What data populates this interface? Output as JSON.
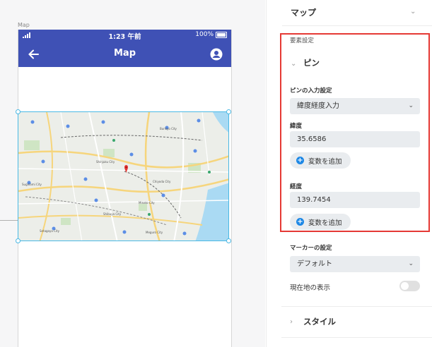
{
  "canvas": {
    "frame_label": "Map",
    "status_bar": {
      "time": "1:23 午前",
      "battery": "100%"
    },
    "app_bar": {
      "title": "Map"
    }
  },
  "panel": {
    "map_section": {
      "title": "マップ"
    },
    "element_settings_label": "要素設定",
    "pin_section": {
      "title": "ピン"
    },
    "pin_input_label": "ピンの入力設定",
    "pin_input_value": "緯度経度入力",
    "latitude_label": "緯度",
    "latitude_value": "35.6586",
    "longitude_label": "経度",
    "longitude_value": "139.7454",
    "add_variable_label": "変数を追加",
    "marker_label": "マーカーの設定",
    "marker_value": "デフォルト",
    "current_location_label": "現在地の表示",
    "current_location_on": false,
    "style_section": {
      "title": "スタイル"
    }
  },
  "colors": {
    "app_bar": "#3f51b5",
    "selection": "#4ab8e4",
    "highlight": "#e53935",
    "add_icon": "#1e88e5"
  }
}
